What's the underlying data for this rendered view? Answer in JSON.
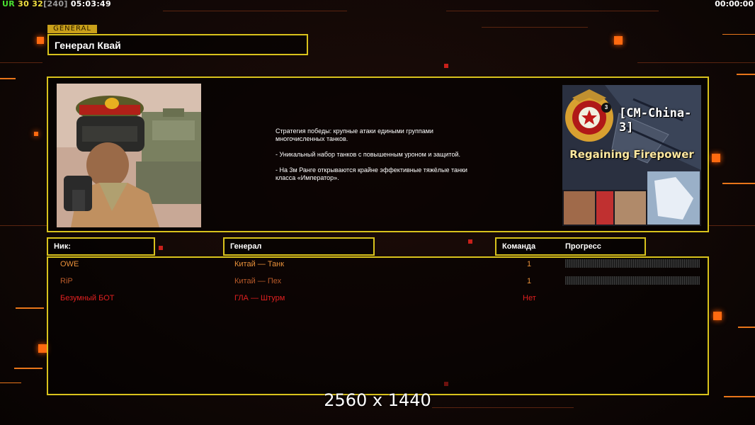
{
  "topbar": {
    "ur": "UR",
    "v1": "30",
    "v2": "32",
    "v3": "[240]",
    "clock": "05:03:49",
    "timer_right": "00:00:00"
  },
  "general": {
    "tag": "GENERAL",
    "name": "Генерал Квай",
    "description": "Стратегия победы: крупные атаки едиными группами\n многочисленных танков.\n\n- Уникальный набор танков с повышенным уроном и защитой.\n\n- На 3м Ранге открываются крайне эффективные тяжёлые танки\n класса «Император».",
    "map_card": {
      "badge": "3",
      "title": "[CM-China-3]",
      "subtitle": "Regaining Firepower"
    }
  },
  "table": {
    "headers": {
      "nick": "Ник:",
      "general": "Генерал",
      "team": "Команда",
      "progress": "Прогресс"
    },
    "rows": [
      {
        "nick": "OWE",
        "general": "Китай — Танк",
        "team": "1",
        "has_progress": true,
        "color": "#e8903a"
      },
      {
        "nick": "RiP",
        "general": "Китай — Пех",
        "team": "1",
        "has_progress": true,
        "color": "#b85a2a"
      },
      {
        "nick": "Безумный БОТ",
        "general": "ГЛА — Штурм",
        "team": "Нет",
        "has_progress": false,
        "color": "#e02020"
      }
    ]
  },
  "watermark": "2560 x 1440",
  "colors": {
    "frame": "#d8c21c",
    "accent": "#ff6a10",
    "ur": "#49e030",
    "v1": "#f0e040",
    "v3": "#9a9a9a"
  }
}
